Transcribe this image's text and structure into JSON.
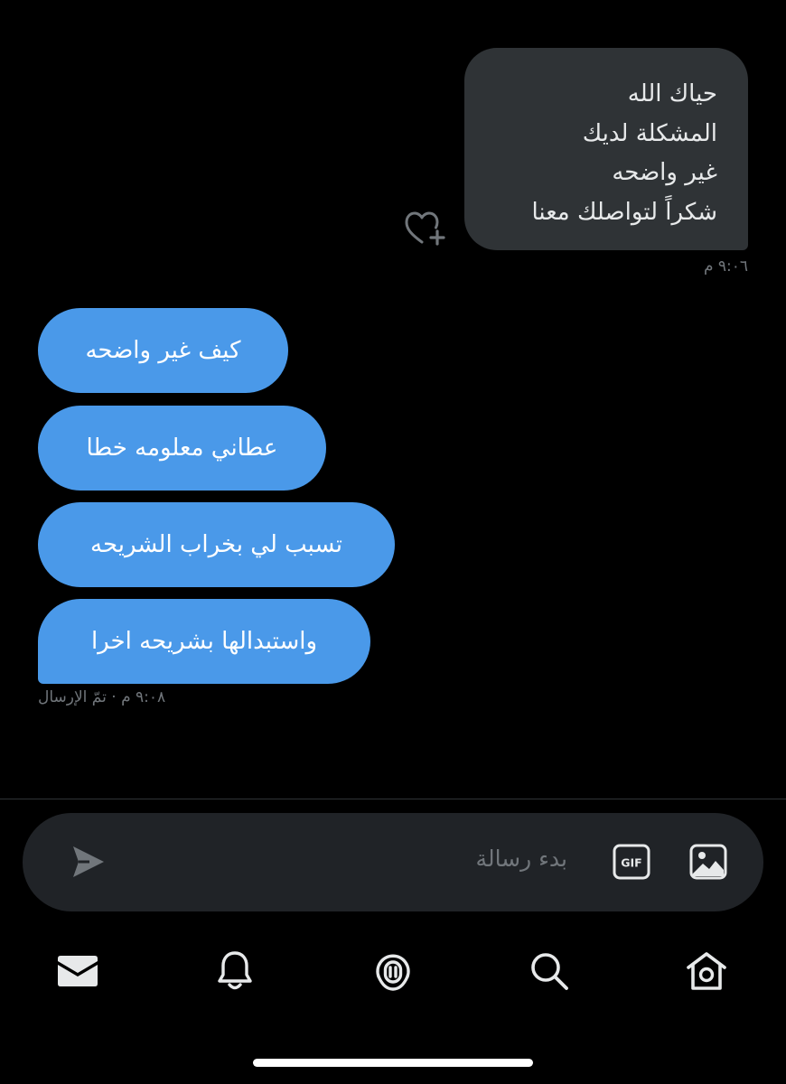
{
  "conversation": {
    "received": {
      "lines": [
        "حياك الله",
        "المشكلة لديك",
        "غير واضحه",
        "شكراً لتواصلك معنا"
      ],
      "time": "٩:٠٦ م"
    },
    "sent": {
      "messages": [
        "كيف غير واضحه",
        "عطاني معلومه خطا",
        "تسبب لي بخراب الشريحه",
        "واستبدالها بشريحه اخرا"
      ],
      "status": "٩:٠٨ م · تمّ الإرسال"
    }
  },
  "composer": {
    "placeholder": "بدء رسالة",
    "gif_label": "GIF"
  },
  "icons": {
    "react": "heart-plus-icon",
    "send": "send-icon",
    "gif": "gif-icon",
    "image": "image-icon",
    "tabs": [
      "mail-icon",
      "bell-icon",
      "spaces-icon",
      "search-icon",
      "home-icon"
    ]
  },
  "colors": {
    "background": "#000000",
    "received_bubble": "#2f3336",
    "sent_bubble": "#4a99e9",
    "muted_text": "#71767b",
    "composer_bg": "#202327"
  }
}
